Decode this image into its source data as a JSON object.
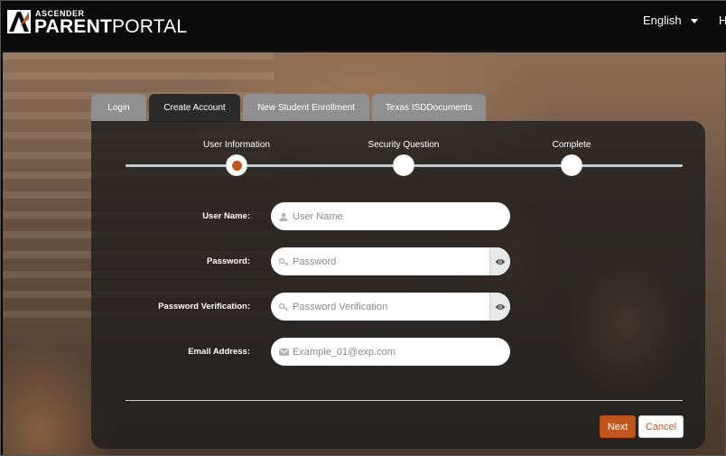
{
  "header": {
    "brand_small": "ASCENDER",
    "brand_bold": "PARENT",
    "brand_light": "PORTAL",
    "language": "English",
    "help_letter": "H"
  },
  "tabs": [
    {
      "label": "Login",
      "active": false
    },
    {
      "label": "Create Account",
      "active": true
    },
    {
      "label": "New Student Enrollment",
      "active": false
    },
    {
      "label": "Texas ISDDocuments",
      "active": false
    }
  ],
  "steps": [
    {
      "label": "User Information",
      "current": true
    },
    {
      "label": "Security Question",
      "current": false
    },
    {
      "label": "Complete",
      "current": false
    }
  ],
  "form": {
    "username": {
      "label": "User Name:",
      "placeholder": "User Name",
      "value": ""
    },
    "password": {
      "label": "Password:",
      "placeholder": "Password",
      "value": ""
    },
    "password_verification": {
      "label": "Password Verification:",
      "placeholder": "Password Verification",
      "value": ""
    },
    "email": {
      "label": "Email Address:",
      "placeholder": "Example_01@exp.com",
      "value": ""
    }
  },
  "buttons": {
    "next": "Next",
    "cancel": "Cancel"
  },
  "colors": {
    "accent": "#c0561d",
    "header_bg": "#0b0b0b",
    "tab_inactive": "#8f8f8f",
    "tab_active": "#2b2b2b"
  }
}
